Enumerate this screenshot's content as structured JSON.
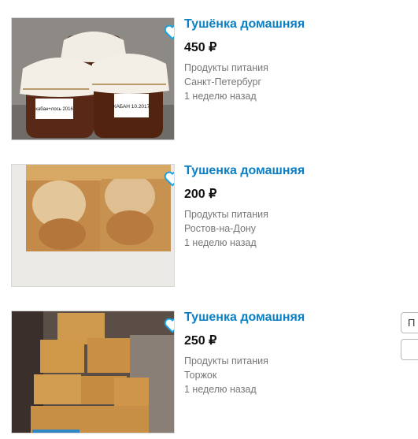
{
  "listings": [
    {
      "title": "Тушёнка домашняя",
      "price": "450 ₽",
      "category": "Продукты питания",
      "location": "Санкт-Петербург",
      "posted": "1 неделю назад",
      "photo_labels": [
        "кабан+лось 2016",
        "КАБАН 10.2017"
      ]
    },
    {
      "title": "Тушенка домашняя",
      "price": "200 ₽",
      "category": "Продукты питания",
      "location": "Ростов-на-Дону",
      "posted": "1 неделю назад"
    },
    {
      "title": "Тушенка домашняя",
      "price": "250 ₽",
      "category": "Продукты питания",
      "location": "Торжок",
      "posted": "1 неделю назад"
    }
  ],
  "side_buttons": [
    {
      "label": "П"
    },
    {
      "label": ""
    }
  ],
  "icons": {
    "favorite": "heart-outline-icon"
  },
  "colors": {
    "title": "#0a7fc4",
    "price": "#111111",
    "meta": "#777777",
    "heart": "#1aa3e0"
  }
}
